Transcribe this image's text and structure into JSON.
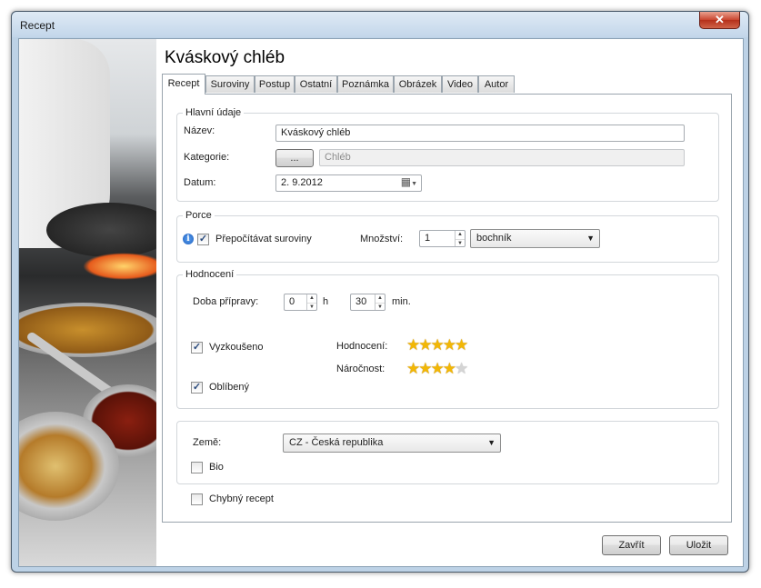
{
  "window": {
    "title": "Recept",
    "close_glyph": "✕"
  },
  "heading": "Kváskový chléb",
  "tabs": [
    {
      "label": "Recept"
    },
    {
      "label": "Suroviny"
    },
    {
      "label": "Postup"
    },
    {
      "label": "Ostatní"
    },
    {
      "label": "Poznámka"
    },
    {
      "label": "Obrázek"
    },
    {
      "label": "Video"
    },
    {
      "label": "Autor"
    }
  ],
  "main_info": {
    "title": "Hlavní údaje",
    "name_label": "Název:",
    "name_value": "Kváskový chléb",
    "category_label": "Kategorie:",
    "category_button": "...",
    "category_value": "Chléb",
    "date_label": "Datum:",
    "date_value": "2.  9.2012"
  },
  "portions": {
    "title": "Porce",
    "recalc_label": "Přepočítávat suroviny",
    "recalc_checked": true,
    "amount_label": "Množství:",
    "amount_value": "1",
    "unit_value": "bochník"
  },
  "rating": {
    "title": "Hodnocení",
    "prep_label": "Doba přípravy:",
    "hours_value": "0",
    "hours_unit": "h",
    "minutes_value": "30",
    "minutes_unit": "min.",
    "tried_label": "Vyzkoušeno",
    "tried_checked": true,
    "favorite_label": "Oblíbený",
    "favorite_checked": true,
    "rating_label": "Hodnocení:",
    "rating_stars": 5,
    "difficulty_label": "Náročnost:",
    "difficulty_stars": 4,
    "max_stars": 5
  },
  "origin": {
    "country_label": "Země:",
    "country_value": "CZ - Česká republika",
    "bio_label": "Bio",
    "bio_checked": false
  },
  "faulty": {
    "label": "Chybný recept",
    "checked": false
  },
  "buttons": {
    "close": "Zavřít",
    "save": "Uložit"
  },
  "glyphs": {
    "check": "✓",
    "dropdown": "▼",
    "spin_up": "▲",
    "spin_down": "▼",
    "info": "i",
    "calendar": "▦"
  },
  "icons": [
    "close-icon",
    "info-icon",
    "calendar-icon",
    "dropdown-arrow-icon",
    "star-icon"
  ]
}
